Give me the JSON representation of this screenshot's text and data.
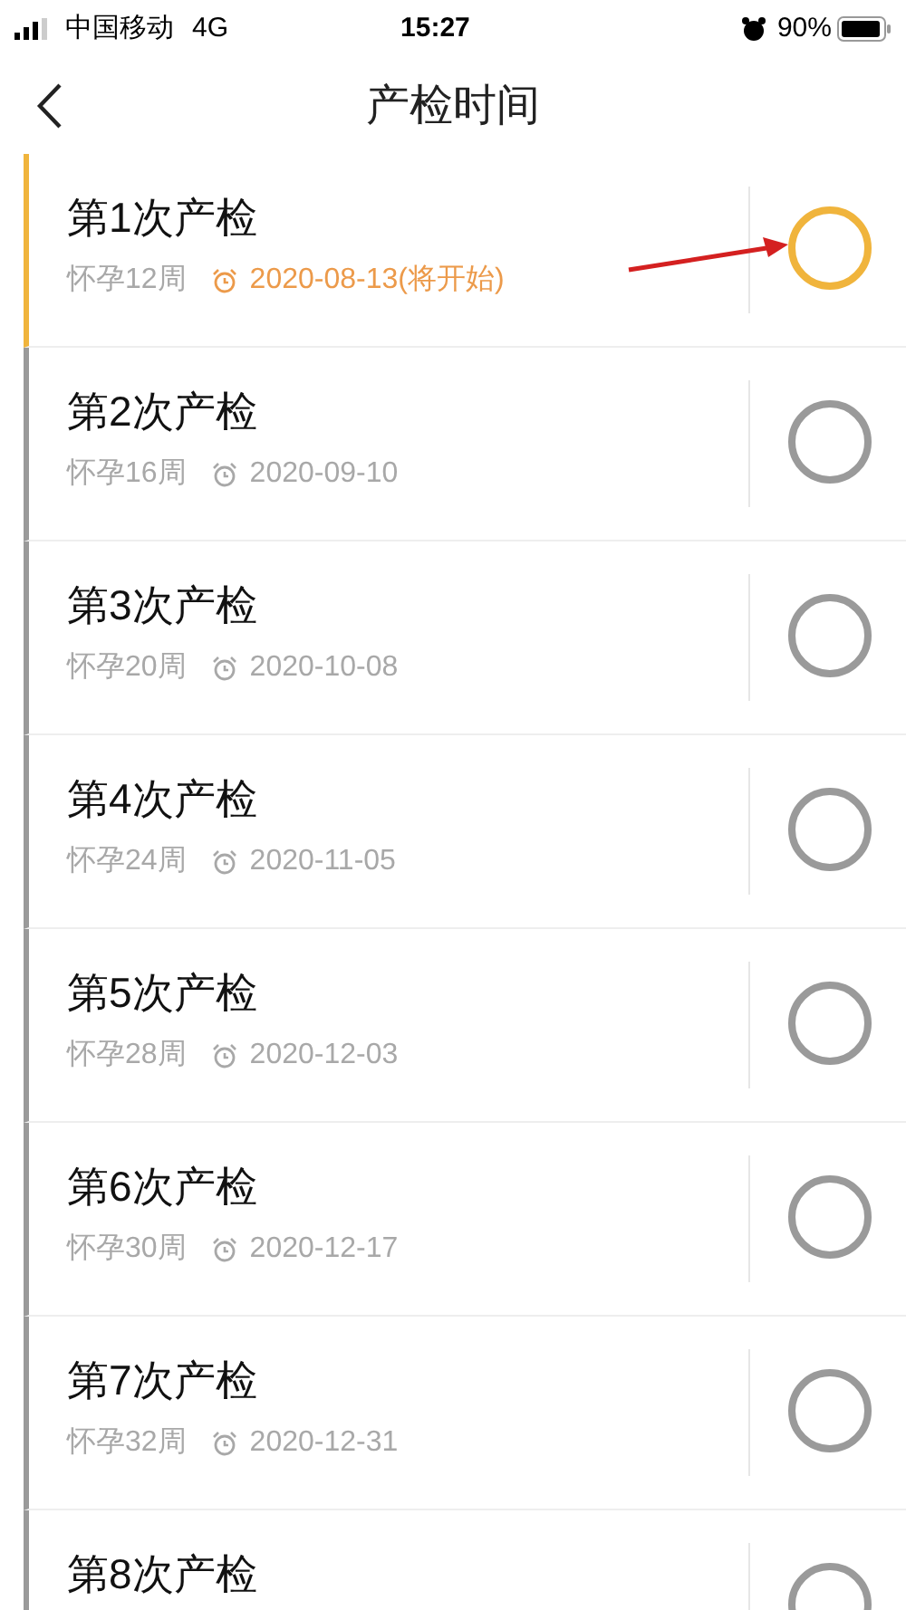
{
  "status_bar": {
    "carrier": "中国移动",
    "network": "4G",
    "time": "15:27",
    "battery": "90%"
  },
  "nav": {
    "title": "产检时间"
  },
  "checkups": [
    {
      "title": "第1次产检",
      "week": "怀孕12周",
      "date": "2020-08-13(将开始)",
      "upcoming": true
    },
    {
      "title": "第2次产检",
      "week": "怀孕16周",
      "date": "2020-09-10",
      "upcoming": false
    },
    {
      "title": "第3次产检",
      "week": "怀孕20周",
      "date": "2020-10-08",
      "upcoming": false
    },
    {
      "title": "第4次产检",
      "week": "怀孕24周",
      "date": "2020-11-05",
      "upcoming": false
    },
    {
      "title": "第5次产检",
      "week": "怀孕28周",
      "date": "2020-12-03",
      "upcoming": false
    },
    {
      "title": "第6次产检",
      "week": "怀孕30周",
      "date": "2020-12-17",
      "upcoming": false
    },
    {
      "title": "第7次产检",
      "week": "怀孕32周",
      "date": "2020-12-31",
      "upcoming": false
    },
    {
      "title": "第8次产检",
      "upcoming": false
    }
  ]
}
